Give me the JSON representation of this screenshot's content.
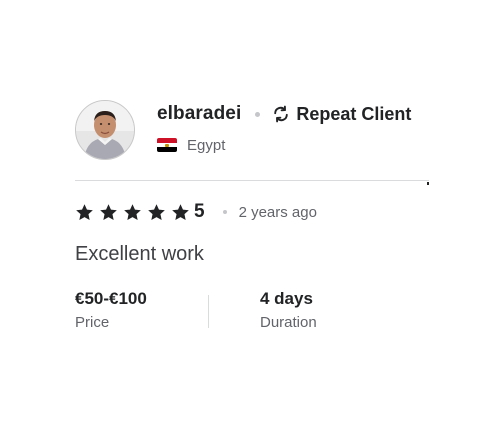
{
  "reviewer": {
    "username": "elbaradei",
    "badge": "Repeat Client",
    "badge_icon": "repeat-icon",
    "country": "Egypt",
    "country_flag_icon": "egypt-flag-icon",
    "avatar_icon": "user-avatar"
  },
  "rating": {
    "stars": 5,
    "max_stars": 5,
    "value": "5",
    "time_ago": "2 years ago",
    "star_color": "#222325"
  },
  "review": {
    "text": "Excellent work"
  },
  "meta": {
    "price_value": "€50-€100",
    "price_label": "Price",
    "duration_value": "4 days",
    "duration_label": "Duration"
  },
  "colors": {
    "primary_text": "#222325",
    "secondary_text": "#62646a",
    "divider": "#dadbdd"
  }
}
